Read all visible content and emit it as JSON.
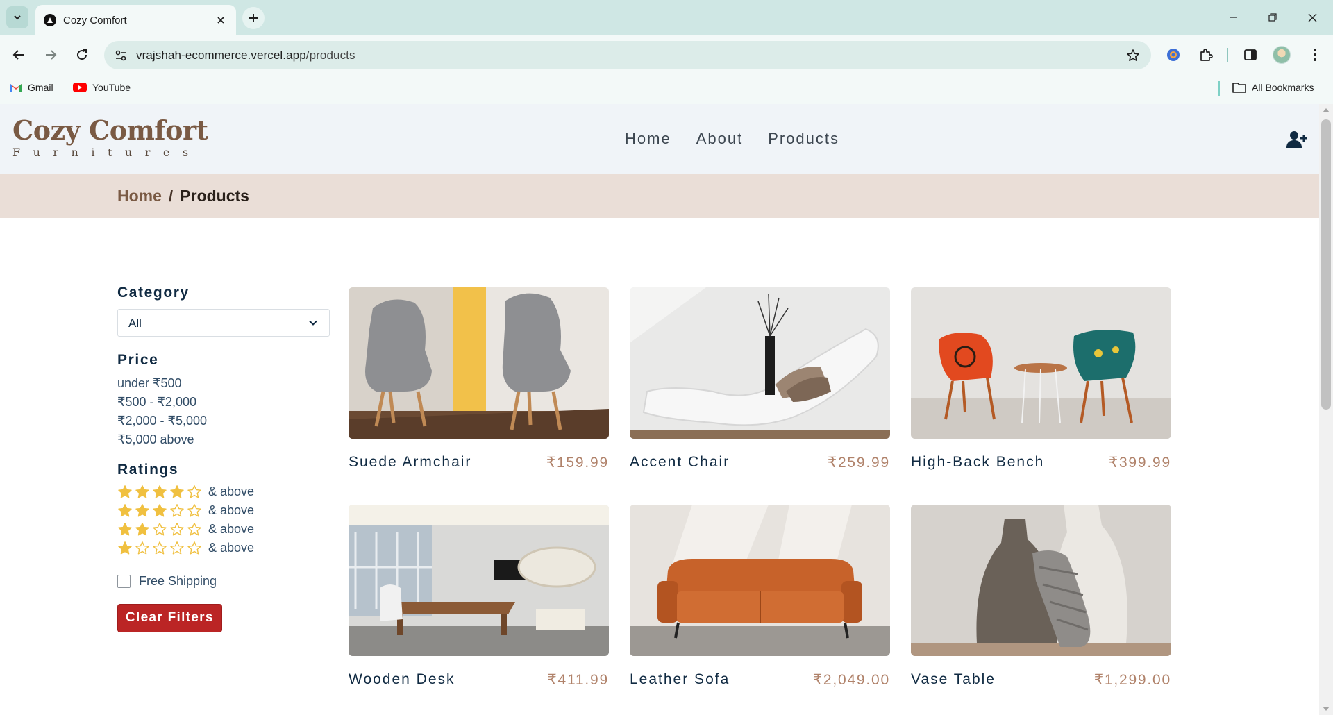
{
  "browser": {
    "tab_title": "Cozy Comfort",
    "url_host": "vrajshah-ecommerce.vercel.app",
    "url_path": "/products",
    "bookmarks": [
      {
        "label": "Gmail",
        "icon": "gmail-icon"
      },
      {
        "label": "YouTube",
        "icon": "youtube-icon"
      }
    ],
    "all_bookmarks_label": "All Bookmarks"
  },
  "site": {
    "logo_main": "Cozy Comfort",
    "logo_sub": "Furnitures",
    "nav": [
      "Home",
      "About",
      "Products"
    ]
  },
  "breadcrumb": {
    "home": "Home",
    "separator": "/",
    "current": "Products"
  },
  "filters": {
    "category_heading": "Category",
    "category_selected": "All",
    "price_heading": "Price",
    "price_options": [
      "under ₹500",
      "₹500 - ₹2,000",
      "₹2,000 - ₹5,000",
      "₹5,000 above"
    ],
    "ratings_heading": "Ratings",
    "ratings": [
      {
        "stars": 4,
        "label": "& above"
      },
      {
        "stars": 3,
        "label": "& above"
      },
      {
        "stars": 2,
        "label": "& above"
      },
      {
        "stars": 1,
        "label": "& above"
      }
    ],
    "free_shipping_label": "Free Shipping",
    "free_shipping_checked": false,
    "clear_label": "Clear Filters"
  },
  "products": [
    {
      "name": "Suede Armchair",
      "price": "₹159.99"
    },
    {
      "name": "Accent Chair",
      "price": "₹259.99"
    },
    {
      "name": "High-Back Bench",
      "price": "₹399.99"
    },
    {
      "name": "Wooden Desk",
      "price": "₹411.99"
    },
    {
      "name": "Leather Sofa",
      "price": "₹2,049.00"
    },
    {
      "name": "Vase Table",
      "price": "₹1,299.00"
    }
  ],
  "colors": {
    "brand": "#7a5a44",
    "price": "#b0826a",
    "clear_button": "#bb2525",
    "star": "#f0c040"
  }
}
